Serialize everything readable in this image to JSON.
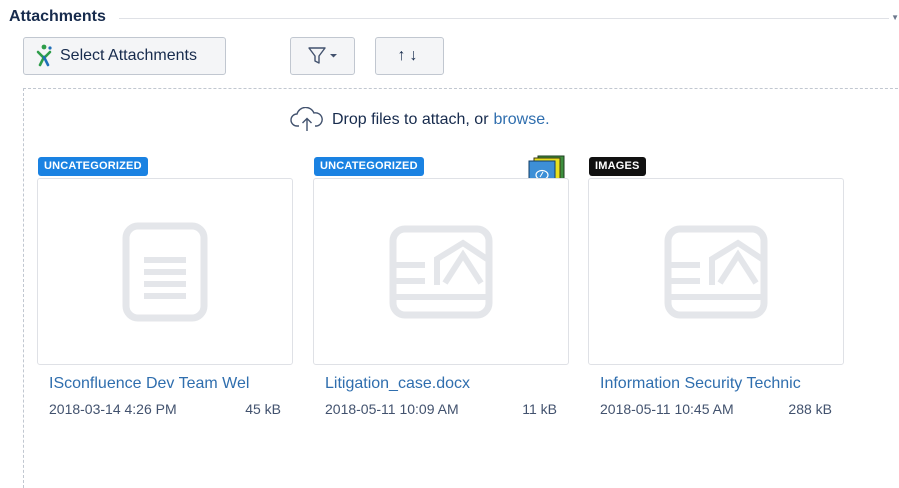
{
  "section": {
    "title": "Attachments"
  },
  "toolbar": {
    "select_label": "Select Attachments",
    "filter_icon": "filter-icon",
    "sort_label": "↑↓"
  },
  "dropzone": {
    "message": "Drop files to attach, or",
    "browse_label": "browse."
  },
  "attachments": [
    {
      "badge": "UNCATEGORIZED",
      "badge_color": "#1a82e2",
      "name": "ISconfluence Dev Team Wel",
      "date": "2018-03-14 4:26 PM",
      "size": "45 kB",
      "thumb_icon": "document-icon"
    },
    {
      "badge": "UNCATEGORIZED",
      "badge_color": "#1a82e2",
      "name": "Litigation_case.docx",
      "date": "2018-05-11 10:09 AM",
      "size": "11 kB",
      "thumb_icon": "image-file-icon",
      "overlay_icon": "stacked-versions-icon"
    },
    {
      "badge": "IMAGES",
      "badge_color": "#111111",
      "name": "Information Security Technic",
      "date": "2018-05-11 10:45 AM",
      "size": "288 kB",
      "thumb_icon": "image-file-icon"
    }
  ]
}
